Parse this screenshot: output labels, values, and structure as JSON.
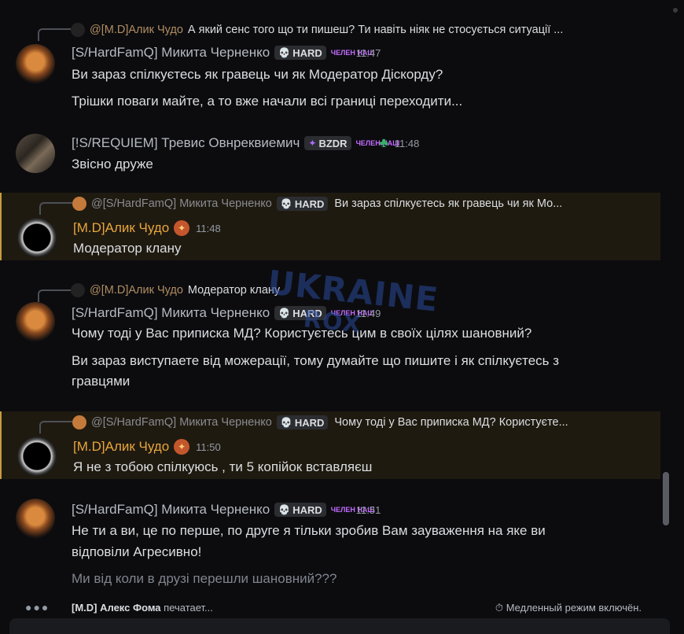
{
  "messages": [
    {
      "reply": {
        "author": "@[M.D]Алик Чудо",
        "text": "А який сенс того що ти пишеш? Ти навіть ніяк не стосується ситуації ..."
      },
      "author": "[S/HardFamQ] Микита Черненко",
      "tag": "HARD",
      "time": "11:47",
      "lines": [
        "Ви зараз спілкуєтесь як гравець чи як Модератор Діскорду?",
        "Трішки поваги майте, а то вже начали всі границі переходити..."
      ]
    },
    {
      "author": "[!S/REQUIEM] Тревис Овнреквиемич",
      "tag": "BZDR",
      "time": "11:48",
      "lines": [
        "Звісно друже"
      ]
    },
    {
      "reply": {
        "author": "@[S/HardFamQ] Микита Черненко",
        "tag": "HARD",
        "text": "Ви зараз спілкуєтесь як гравець чи як Мо..."
      },
      "author": "[M.D]Алик Чудо",
      "time": "11:48",
      "lines": [
        "Модератор клану"
      ]
    },
    {
      "reply": {
        "author": "@[M.D]Алик Чудо",
        "text": "Модератор клану"
      },
      "author": "[S/HardFamQ] Микита Черненко",
      "tag": "HARD",
      "time": "11:49",
      "lines": [
        "Чому тоді у Вас приписка МД? Користуєтесь цим в своїх цілях шановний?",
        "Ви зараз виступаете від можерації, тому думайте що пишите і як спілкуєтесь з",
        "гравцями"
      ]
    },
    {
      "reply": {
        "author": "@[S/HardFamQ] Микита Черненко",
        "tag": "HARD",
        "text": "Чому тоді у Вас приписка МД? Користуєте..."
      },
      "author": "[M.D]Алик Чудо",
      "time": "11:50",
      "lines": [
        "Я не з тобою спілкуюсь , ти 5 копійок вставляєш"
      ]
    },
    {
      "author": "[S/HardFamQ] Микита Черненко",
      "tag": "HARD",
      "time": "11:51",
      "lines": [
        "Не ти а ви, це по перше, по друге я тільки зробив Вам зауваження на яке ви",
        "відповіли Агресивно!",
        "Ми від коли в друзі перешли шановний???"
      ]
    }
  ],
  "typing": {
    "name": "[M.D] Алекс Фома",
    "suffix": "печатает...",
    "slowmode": "Медленный режим включён."
  },
  "badges": {
    "small": "ЧЕЛЕН НАШ"
  },
  "watermark": {
    "text_line1": "UKRAINE",
    "text_line2": "ROX"
  },
  "colors": {
    "mention_bg": "#1f1a10",
    "mention_border": "#c89b3c",
    "gold_name": "#e8a63c"
  }
}
